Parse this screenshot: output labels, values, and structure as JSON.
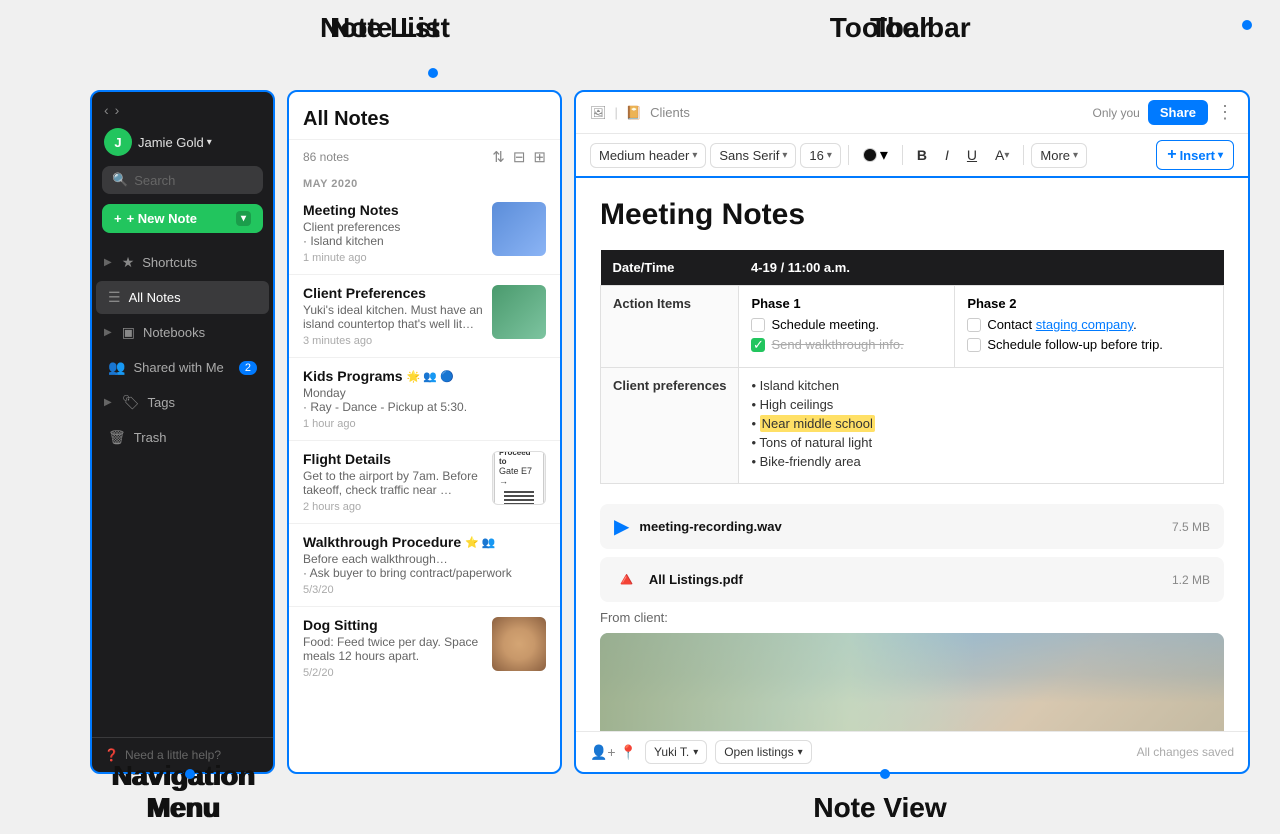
{
  "labels": {
    "note_list_heading": "Note List",
    "toolbar_heading": "Toolbar",
    "nav_heading": "Navigation Menu",
    "note_view_heading": "Note View"
  },
  "nav": {
    "back": "‹",
    "forward": "›",
    "user_name": "Jamie Gold",
    "user_initial": "J",
    "search_placeholder": "Search",
    "new_note_label": "+ New Note",
    "items": [
      {
        "id": "shortcuts",
        "icon": "★",
        "label": "Shortcuts",
        "arrow": "▶",
        "badge": null
      },
      {
        "id": "all-notes",
        "icon": "☰",
        "label": "All Notes",
        "arrow": null,
        "badge": null,
        "active": true
      },
      {
        "id": "notebooks",
        "icon": "▣",
        "label": "Notebooks",
        "arrow": "▶",
        "badge": null
      },
      {
        "id": "shared",
        "icon": "👥",
        "label": "Shared with Me",
        "arrow": null,
        "badge": "2"
      },
      {
        "id": "tags",
        "icon": "🏷",
        "label": "Tags",
        "arrow": "▶",
        "badge": null
      },
      {
        "id": "trash",
        "icon": "🗑",
        "label": "Trash",
        "arrow": null,
        "badge": null
      }
    ],
    "help_label": "Need a little help?"
  },
  "note_list": {
    "title": "All Notes",
    "count": "86 notes",
    "date_group": "MAY 2020",
    "notes": [
      {
        "id": "meeting",
        "title": "Meeting Notes",
        "preview": "Client preferences\n· Island kitchen",
        "time": "1 minute ago",
        "has_thumb": true,
        "thumb_type": "meeting"
      },
      {
        "id": "client",
        "title": "Client Preferences",
        "preview": "Yuki's ideal kitchen. Must have an island countertop that's well lit fr…",
        "time": "3 minutes ago",
        "has_thumb": true,
        "thumb_type": "client"
      },
      {
        "id": "kids",
        "title": "Kids Programs",
        "preview": "Monday\n· Ray - Dance - Pickup at 5:30.",
        "time": "1 hour ago",
        "has_thumb": false,
        "icons": "🌟 👥 🔵"
      },
      {
        "id": "flight",
        "title": "Flight Details",
        "preview": "Get to the airport by 7am. Before takeoff, check traffic near …",
        "time": "2 hours ago",
        "has_thumb": true,
        "thumb_type": "flight"
      },
      {
        "id": "walkthrough",
        "title": "Walkthrough Procedure",
        "preview": "Before each walkthrough…\n· Ask buyer to bring contract/paperwork",
        "time": "5/3/20",
        "has_thumb": false,
        "icons": "⭐ 👥"
      },
      {
        "id": "dog",
        "title": "Dog Sitting",
        "preview": "Food: Feed twice per day. Space meals 12 hours apart.",
        "time": "5/2/20",
        "has_thumb": true,
        "thumb_type": "dog"
      }
    ]
  },
  "note_view": {
    "top_bar": {
      "notebook_icon": "📔",
      "notebook_name": "Clients",
      "share_visibility": "Only you",
      "share_btn": "Share"
    },
    "toolbar": {
      "heading_dropdown": "Medium header",
      "font_dropdown": "Sans Serif",
      "size_dropdown": "16",
      "bold": "B",
      "italic": "I",
      "underline": "U",
      "highlight": "A",
      "more_dropdown": "More",
      "insert_btn": "+ Insert"
    },
    "note_title": "Meeting Notes",
    "table": {
      "headers": [
        "Date/Time",
        "4-19 / 11:00 a.m."
      ],
      "rows": [
        {
          "label": "Action Items",
          "phase1_label": "Phase 1",
          "phase1_items": [
            {
              "text": "Schedule meeting.",
              "done": false
            },
            {
              "text": "Send walkthrough info.",
              "done": true
            }
          ],
          "phase2_label": "Phase 2",
          "phase2_items": [
            {
              "text": "Contact staging company.",
              "done": false,
              "link": true
            },
            {
              "text": "Schedule follow-up before trip.",
              "done": false
            }
          ]
        }
      ],
      "client_prefs_label": "Client preferences",
      "client_prefs": [
        "Island kitchen",
        "High ceilings",
        "Near middle school",
        "Tons of natural light",
        "Bike-friendly area"
      ],
      "highlight_item": "Near middle school"
    },
    "files": [
      {
        "id": "wav",
        "icon": "▶",
        "name": "meeting-recording.wav",
        "size": "7.5 MB",
        "type": "wav"
      },
      {
        "id": "pdf",
        "icon": "🔺",
        "name": "All Listings.pdf",
        "size": "1.2 MB",
        "type": "pdf"
      }
    ],
    "from_client_label": "From client:",
    "footer": {
      "user_label": "Yuki T.",
      "listing_label": "Open listings",
      "saved_text": "All changes saved"
    }
  }
}
